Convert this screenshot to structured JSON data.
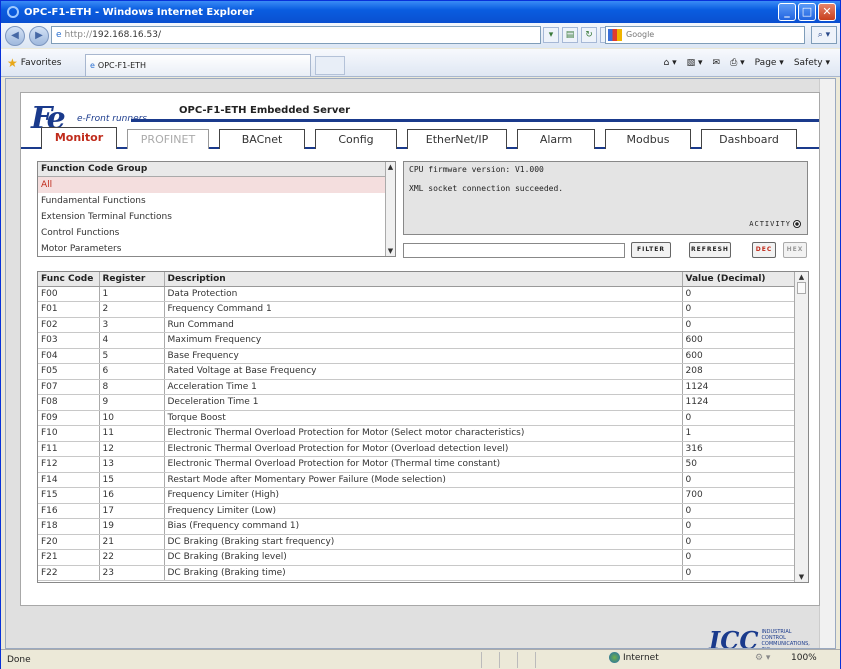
{
  "window": {
    "title": "OPC-F1-ETH - Windows Internet Explorer"
  },
  "address": {
    "prefix": "http://",
    "host": "192.168.16.53/"
  },
  "search": {
    "placeholder": "Google"
  },
  "favorites": {
    "label": "Favorites",
    "tab_label": "OPC-F1-ETH"
  },
  "command_bar": {
    "page": "Page ▾",
    "safety": "Safety ▾"
  },
  "app": {
    "logo_tagline": "e-Front runners",
    "title": "OPC-F1-ETH Embedded Server"
  },
  "tabs": [
    "Monitor",
    "PROFINET",
    "BACnet",
    "Config",
    "EtherNet/IP",
    "Alarm",
    "Modbus",
    "Dashboard"
  ],
  "function_groups": {
    "header": "Function Code Group",
    "items": [
      "All",
      "Fundamental Functions",
      "Extension Terminal Functions",
      "Control Functions",
      "Motor Parameters"
    ],
    "selected": "All"
  },
  "status": {
    "firmware": "CPU firmware version: V1.000",
    "message": "XML socket connection succeeded.",
    "activity": "ACTIVITY"
  },
  "buttons": {
    "filter": "FILTER",
    "refresh": "REFRESH",
    "dec": "DEC",
    "hex": "HEX"
  },
  "table": {
    "headers": [
      "Func Code",
      "Register",
      "Description",
      "Value (Decimal)"
    ],
    "rows": [
      [
        "F00",
        "1",
        "Data Protection",
        "0"
      ],
      [
        "F01",
        "2",
        "Frequency Command 1",
        "0"
      ],
      [
        "F02",
        "3",
        "Run Command",
        "0"
      ],
      [
        "F03",
        "4",
        "Maximum Frequency",
        "600"
      ],
      [
        "F04",
        "5",
        "Base Frequency",
        "600"
      ],
      [
        "F05",
        "6",
        "Rated Voltage at Base Frequency",
        "208"
      ],
      [
        "F07",
        "8",
        "Acceleration Time 1",
        "1124"
      ],
      [
        "F08",
        "9",
        "Deceleration Time 1",
        "1124"
      ],
      [
        "F09",
        "10",
        "Torque Boost",
        "0"
      ],
      [
        "F10",
        "11",
        "Electronic Thermal Overload Protection for Motor (Select motor characteristics)",
        "1"
      ],
      [
        "F11",
        "12",
        "Electronic Thermal Overload Protection for Motor (Overload detection level)",
        "316"
      ],
      [
        "F12",
        "13",
        "Electronic Thermal Overload Protection for Motor (Thermal time constant)",
        "50"
      ],
      [
        "F14",
        "15",
        "Restart Mode after Momentary Power Failure (Mode selection)",
        "0"
      ],
      [
        "F15",
        "16",
        "Frequency Limiter (High)",
        "700"
      ],
      [
        "F16",
        "17",
        "Frequency Limiter (Low)",
        "0"
      ],
      [
        "F18",
        "19",
        "Bias (Frequency command 1)",
        "0"
      ],
      [
        "F20",
        "21",
        "DC Braking (Braking start frequency)",
        "0"
      ],
      [
        "F21",
        "22",
        "DC Braking (Braking level)",
        "0"
      ],
      [
        "F22",
        "23",
        "DC Braking (Braking time)",
        "0"
      ]
    ]
  },
  "footer_logo": {
    "mark": "ICC",
    "line1": "INDUSTRIAL",
    "line2": "CONTROL",
    "line3": "COMMUNICATIONS, INC."
  },
  "statusbar": {
    "left": "Done",
    "zone": "Internet",
    "zoom": "100%"
  }
}
